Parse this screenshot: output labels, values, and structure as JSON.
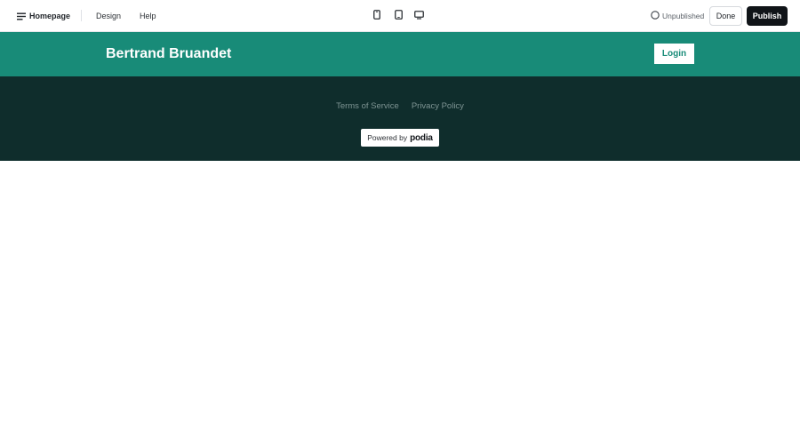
{
  "topbar": {
    "page_selector_label": "Homepage",
    "page_selector_icon": "menu-lines-icon",
    "nav_links": [
      {
        "label": "Design"
      },
      {
        "label": "Help"
      }
    ],
    "device_toggles": [
      {
        "icon": "mobile-device-icon"
      },
      {
        "icon": "tablet-device-icon"
      },
      {
        "icon": "desktop-device-icon"
      }
    ],
    "status": {
      "label": "Unpublished",
      "icon": "circle-outline-icon"
    },
    "done_label": "Done",
    "publish_label": "Publish"
  },
  "site": {
    "title": "Bertrand Bruandet",
    "login_label": "Login",
    "footer": {
      "links": [
        {
          "label": "Terms of Service"
        },
        {
          "label": "Privacy Policy"
        }
      ],
      "powered_by_text": "Powered by",
      "powered_by_brand": "podia"
    }
  },
  "colors": {
    "header_bg": "#188b78",
    "footer_bg": "#0f2d2c",
    "publish_bg": "#101418",
    "footer_link": "#7e9493"
  }
}
